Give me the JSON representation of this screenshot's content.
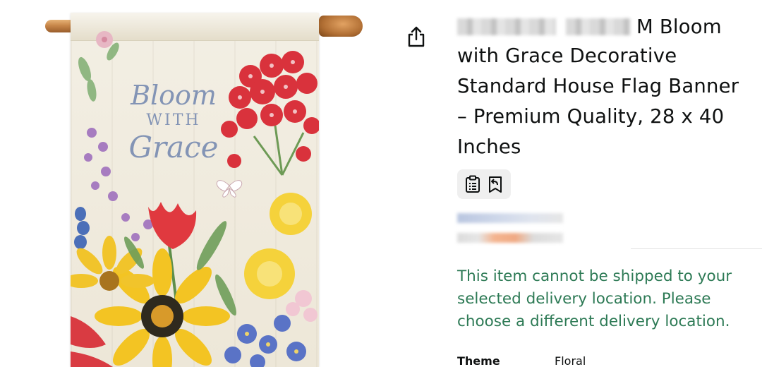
{
  "product": {
    "title_visible_start": "M Bloom",
    "title_lines": [
      "with Grace Decorative",
      "Standard House Flag Banner",
      "– Premium Quality, 28 x 40",
      "Inches"
    ],
    "flag_text": {
      "line1": "Bloom",
      "line2": "WITH",
      "line3": "Grace"
    }
  },
  "icons": {
    "share": "share-icon",
    "clipboard": "clipboard-icon",
    "return": "return-icon"
  },
  "shipping": {
    "message": "This item cannot be shipped to your selected delivery location. Please choose a different delivery location."
  },
  "specs": [
    {
      "label": "Theme",
      "value": "Floral"
    }
  ],
  "colors": {
    "shipping_message": "#2d7a55",
    "title": "#0f1111",
    "icon_chip_bg": "#efefef"
  }
}
